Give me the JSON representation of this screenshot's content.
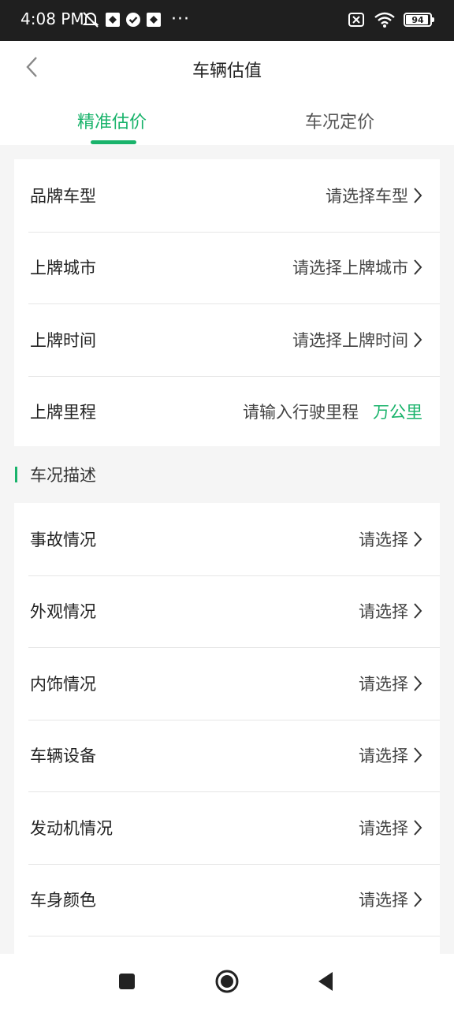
{
  "status_bar": {
    "time": "4:08 PM",
    "battery": "94",
    "battery_fraction": 0.94,
    "icons": [
      "mute-icon",
      "app-icon",
      "check-icon",
      "app-icon",
      "more-dots-icon",
      "no-sim-icon",
      "wifi-icon",
      "battery-icon"
    ]
  },
  "header": {
    "title": "车辆估值",
    "back_icon": "chevron-left-icon",
    "tabs": [
      {
        "label": "精准估价",
        "active": true
      },
      {
        "label": "车况定价",
        "active": false
      }
    ]
  },
  "basic_info": [
    {
      "label": "品牌车型",
      "value": "请选择车型"
    },
    {
      "label": "上牌城市",
      "value": "请选择上牌城市"
    },
    {
      "label": "上牌时间",
      "value": "请选择上牌时间"
    }
  ],
  "mileage": {
    "label": "上牌里程",
    "placeholder": "请输入行驶里程",
    "unit": "万公里"
  },
  "condition_section": {
    "title": "车况描述"
  },
  "condition_items": [
    {
      "label": "事故情况",
      "value": "请选择"
    },
    {
      "label": "外观情况",
      "value": "请选择"
    },
    {
      "label": "内饰情况",
      "value": "请选择"
    },
    {
      "label": "车辆设备",
      "value": "请选择"
    },
    {
      "label": "发动机情况",
      "value": "请选择"
    },
    {
      "label": "车身颜色",
      "value": "请选择"
    }
  ],
  "colors": {
    "accent": "#19b36b",
    "status_bar": "#1f1f1f",
    "background": "#f5f5f5"
  },
  "nav_bar": {
    "icons": [
      "recents-square-icon",
      "home-circle-icon",
      "back-triangle-icon"
    ]
  }
}
